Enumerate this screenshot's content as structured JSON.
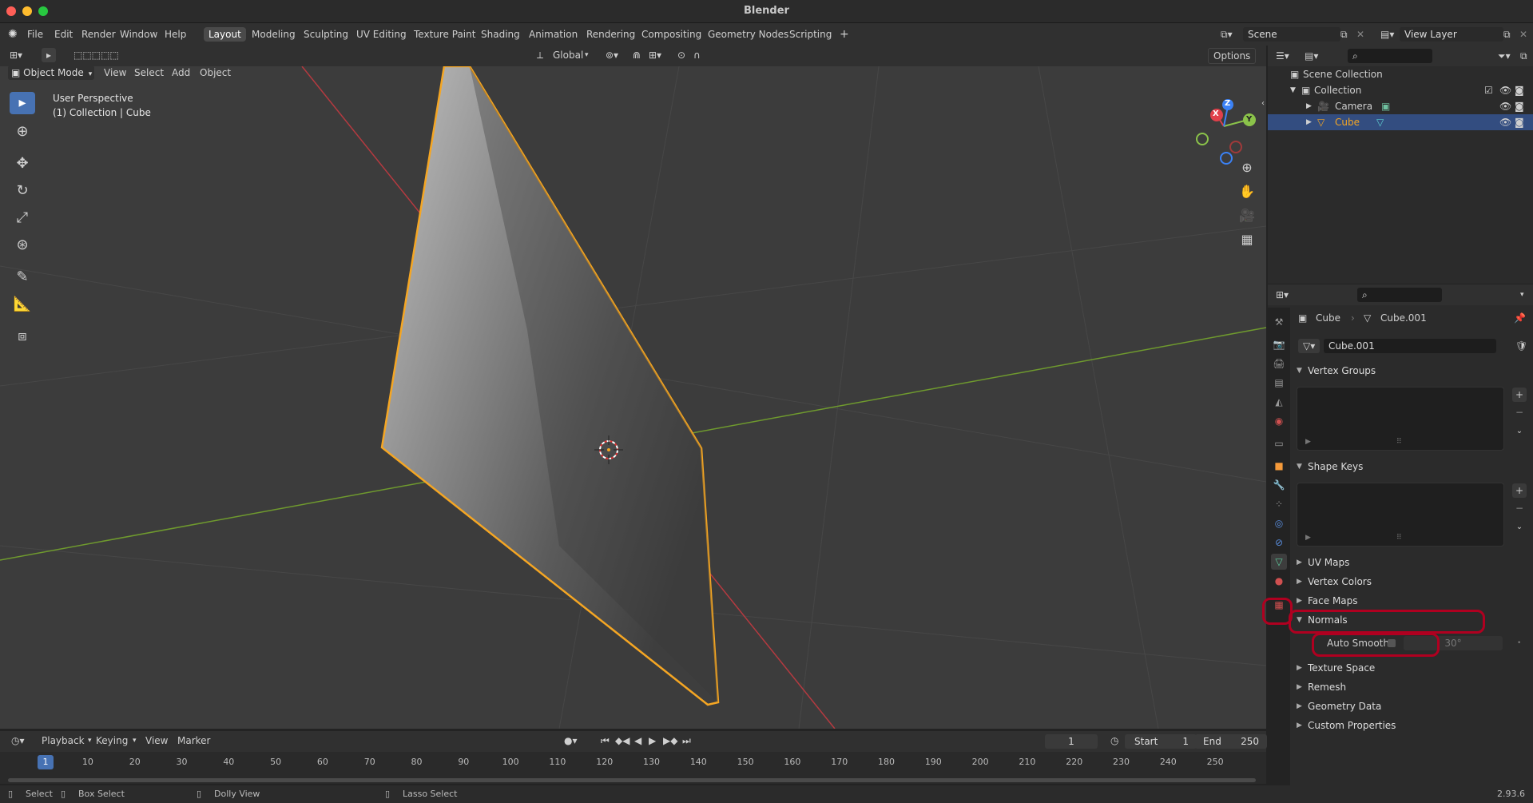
{
  "window": {
    "title": "Blender"
  },
  "menu": [
    "File",
    "Edit",
    "Render",
    "Window",
    "Help"
  ],
  "workspaces": [
    "Layout",
    "Modeling",
    "Sculpting",
    "UV Editing",
    "Texture Paint",
    "Shading",
    "Animation",
    "Rendering",
    "Compositing",
    "Geometry Nodes",
    "Scripting"
  ],
  "active_workspace": "Layout",
  "scene_name": "Scene",
  "view_layer_name": "View Layer",
  "viewport_header": {
    "mode": "Object Mode",
    "menus": [
      "View",
      "Select",
      "Add",
      "Object"
    ],
    "transform_orientation": "Global",
    "options_label": "Options"
  },
  "viewport_info": {
    "view_name": "User Perspective",
    "collection_line": "(1) Collection | Cube"
  },
  "gizmo_axes": {
    "x": "X",
    "y": "Y",
    "z": "Z"
  },
  "outliner": {
    "root": "Scene Collection",
    "collection": "Collection",
    "items": [
      "Camera",
      "Cube"
    ],
    "selected": "Cube"
  },
  "properties": {
    "object_name": "Cube",
    "mesh_name": "Cube.001",
    "mesh_field": "Cube.001",
    "panels": {
      "vertex_groups": "Vertex Groups",
      "shape_keys": "Shape Keys",
      "uv_maps": "UV Maps",
      "vertex_colors": "Vertex Colors",
      "face_maps": "Face Maps",
      "normals": "Normals",
      "texture_space": "Texture Space",
      "remesh": "Remesh",
      "geometry_data": "Geometry Data",
      "custom_properties": "Custom Properties"
    },
    "auto_smooth_label": "Auto Smooth",
    "auto_smooth_angle": "30°"
  },
  "timeline": {
    "menus": [
      "Playback",
      "Keying",
      "View",
      "Marker"
    ],
    "current_frame": "1",
    "start_label": "Start",
    "start_value": "1",
    "end_label": "End",
    "end_value": "250",
    "ticks": [
      "1",
      "10",
      "20",
      "30",
      "40",
      "50",
      "60",
      "70",
      "80",
      "90",
      "100",
      "110",
      "120",
      "130",
      "140",
      "150",
      "160",
      "170",
      "180",
      "190",
      "200",
      "210",
      "220",
      "230",
      "240",
      "250"
    ]
  },
  "statusbar": {
    "select": "Select",
    "box_select": "Box Select",
    "dolly_view": "Dolly View",
    "lasso_select": "Lasso Select",
    "version": "2.93.6"
  },
  "colors": {
    "accent": "#4772b3",
    "selection_outline": "#f5a623",
    "highlight_red": "#b00020",
    "x_axis": "#e0404a",
    "y_axis": "#8bc34a",
    "z_axis": "#3b82f6"
  }
}
